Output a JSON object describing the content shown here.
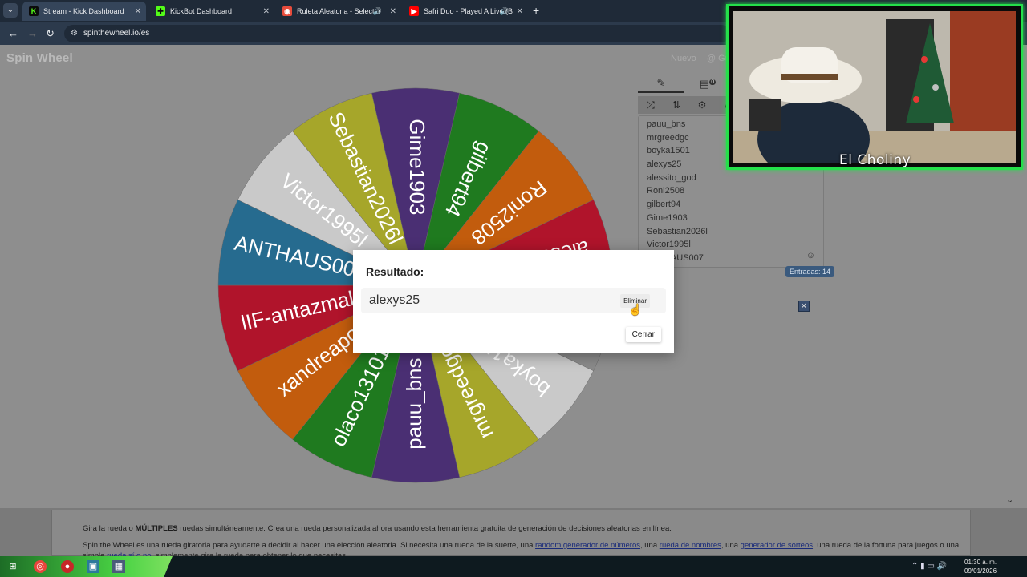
{
  "browser": {
    "tabs": [
      {
        "title": "Stream - Kick Dashboard",
        "active": true,
        "favicon": "kick-icon",
        "favicon_color": "#53fc18"
      },
      {
        "title": "KickBot Dashboard",
        "active": false,
        "favicon": "kickbot-icon",
        "favicon_color": "#53fc18"
      },
      {
        "title": "Ruleta Aleatoria - Selector",
        "active": false,
        "favicon": "wheel-icon",
        "favicon_color": "#e74c3c"
      },
      {
        "title": "Safri Duo - Played A Live (B",
        "active": false,
        "favicon": "youtube-icon",
        "favicon_color": "#ff0000"
      }
    ],
    "url": "spinthewheel.io/es"
  },
  "site": {
    "logo": "Spin Wheel",
    "top_links": [
      "Nuevo",
      "@ Gu"
    ]
  },
  "wheel": {
    "entries": [
      {
        "label": "Gime1903",
        "color": "#4a2f73"
      },
      {
        "label": "gilbert94",
        "color": "#1f7a1f"
      },
      {
        "label": "Roni2508",
        "color": "#c25c0d"
      },
      {
        "label": "alessito_god",
        "color": "#b0142b"
      },
      {
        "label": "alexys25",
        "color": "#8a8a8a"
      },
      {
        "label": "boyka1501",
        "color": "#c9c9c9"
      },
      {
        "label": "mrgreedgc",
        "color": "#a6a62a"
      },
      {
        "label": "pauu_bns",
        "color": "#4a2f73"
      },
      {
        "label": "olaco131017",
        "color": "#1f7a1f"
      },
      {
        "label": "xandreapox",
        "color": "#c25c0d"
      },
      {
        "label": "lIF-antazmall",
        "color": "#b0142b"
      },
      {
        "label": "ANTHAUS007",
        "color": "#266b8f"
      },
      {
        "label": "Victor1995l",
        "color": "#c9c9c9"
      },
      {
        "label": "Sebastian2026l",
        "color": "#a6a62a"
      }
    ]
  },
  "sidebar": {
    "tabs": [
      "edit-icon",
      "results-icon"
    ],
    "results_badge": "0",
    "tools": [
      "shuffle-icon",
      "sort-icon",
      "settings-icon",
      "A"
    ],
    "entries": [
      "pauu_bns",
      "mrgreedgc",
      "boyka1501",
      "alexys25",
      "alessito_god",
      "Roni2508",
      "gilbert94",
      "Gime1903",
      "Sebastian2026l",
      "Victor1995l",
      "ANTHAUS007"
    ],
    "entries_count": "Entradas: 14"
  },
  "dialog": {
    "title": "Resultado:",
    "result": "alexys25",
    "remove_label": "Eliminar",
    "close_label": "Cerrar"
  },
  "info": {
    "line1_prefix": "Gira la rueda o ",
    "line1_bold": "MÚLTIPLES",
    "line1_suffix": " ruedas simultáneamente. Crea una rueda personalizada ahora usando esta herramienta gratuita de generación de decisiones aleatorias en línea.",
    "line2_a": "Spin the Wheel es una rueda giratoria para ayudarte a decidir al hacer una elección aleatoria. Si necesita una rueda de la suerte, una ",
    "link1": "random generador de números",
    "line2_b": ", una ",
    "link2": "rueda de nombres",
    "line2_c": ", una ",
    "link3": "generador de sorteos",
    "line2_d": ", una rueda de la fortuna para juegos o una",
    "line3_a": "simple ",
    "link4": "rueda sí o no",
    "line3_b": ", simplemente gira la rueda para obtener lo que necesitas."
  },
  "webcam": {
    "name": "El Choliny",
    "border_color": "#24e04a"
  },
  "taskbar": {
    "time": "01:30 a. m.",
    "date": "09/01/2026"
  }
}
